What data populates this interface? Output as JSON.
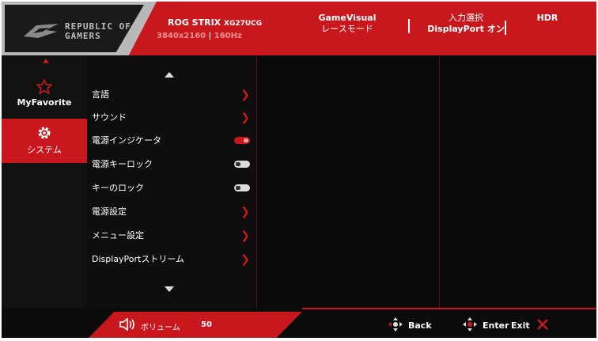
{
  "header": {
    "brand_line1": "REPUBLIC OF",
    "brand_line2": "GAMERS",
    "model": "ROG STRIX",
    "model_code": "XG27UCG",
    "resolution": "3840x2160",
    "refresh": "160Hz",
    "gamevisual_title": "GameVisual",
    "gamevisual_value": "レースモード",
    "input_title": "入力選択",
    "input_value": "DisplayPort オン",
    "hdr_label": "HDR"
  },
  "nav": {
    "items": [
      {
        "label": "MyFavorite",
        "icon": "star-icon"
      },
      {
        "label": "システム",
        "icon": "gear-icon"
      }
    ]
  },
  "menu": {
    "items": [
      {
        "label": "言語",
        "control": "chevron"
      },
      {
        "label": "サウンド",
        "control": "chevron"
      },
      {
        "label": "電源インジケータ",
        "control": "toggle-on"
      },
      {
        "label": "電源キーロック",
        "control": "toggle-off"
      },
      {
        "label": "キーのロック",
        "control": "toggle-off"
      },
      {
        "label": "電源設定",
        "control": "chevron"
      },
      {
        "label": "メニュー設定",
        "control": "chevron"
      },
      {
        "label": "DisplayPortストリーム",
        "control": "chevron"
      }
    ]
  },
  "footer": {
    "volume_label": "ボリューム",
    "volume_value": "50",
    "back_label": "Back",
    "enter_label": "Enter",
    "exit_label": "Exit"
  },
  "colors": {
    "accent": "#c8181e",
    "background": "#0b0b0b"
  }
}
